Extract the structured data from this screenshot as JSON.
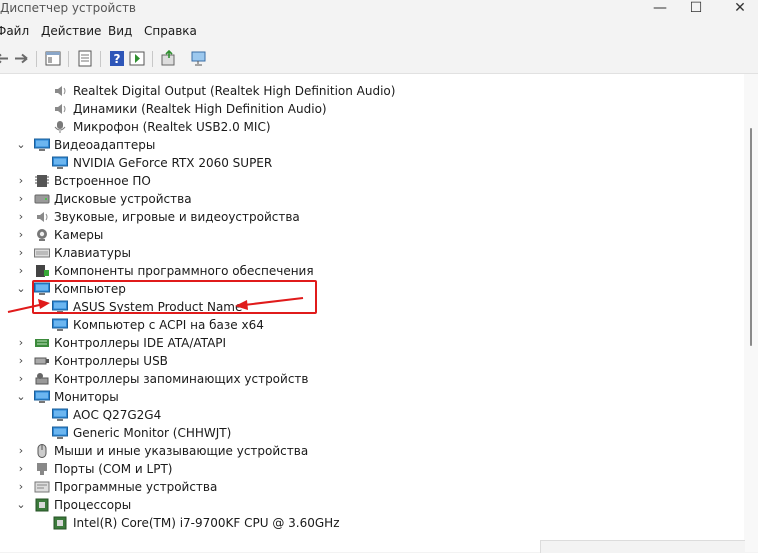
{
  "window": {
    "title": "Диспетчер устройств",
    "minimize_glyph": "—",
    "maximize_glyph": "☐",
    "close_glyph": "✕"
  },
  "menu": {
    "items": [
      "Файл",
      "Действие",
      "Вид",
      "Справка"
    ]
  },
  "toolbar": {
    "buttons": [
      "back-icon",
      "forward-icon",
      "properties-pane-icon",
      "show-hidden-icon",
      "help-icon",
      "action-pane-icon",
      "update-driver-icon",
      "scan-hardware-icon"
    ]
  },
  "tree": {
    "rows": [
      {
        "label": "Realtek Digital Output (Realtek High Definition Audio)",
        "level": 2,
        "icon": "speaker-device-icon"
      },
      {
        "label": "Динамики (Realtek High Definition Audio)",
        "level": 2,
        "icon": "speaker-icon"
      },
      {
        "label": "Микрофон (Realtek USB2.0 MIC)",
        "level": 2,
        "icon": "microphone-icon"
      },
      {
        "label": "Видеоадаптеры",
        "level": 1,
        "expanded": true,
        "icon": "display-adapter-icon"
      },
      {
        "label": "NVIDIA GeForce RTX 2060 SUPER",
        "level": 2,
        "icon": "display-adapter-icon"
      },
      {
        "label": "Встроенное ПО",
        "level": 1,
        "expanded": false,
        "icon": "firmware-icon"
      },
      {
        "label": "Дисковые устройства",
        "level": 1,
        "expanded": false,
        "icon": "disk-icon"
      },
      {
        "label": "Звуковые, игровые и видеоустройства",
        "level": 1,
        "expanded": false,
        "icon": "speaker-icon"
      },
      {
        "label": "Камеры",
        "level": 1,
        "expanded": false,
        "icon": "camera-icon"
      },
      {
        "label": "Клавиатуры",
        "level": 1,
        "expanded": false,
        "icon": "keyboard-icon"
      },
      {
        "label": "Компоненты программного обеспечения",
        "level": 1,
        "expanded": false,
        "icon": "software-component-icon"
      },
      {
        "label": "Компьютер",
        "level": 1,
        "expanded": true,
        "icon": "monitor-icon"
      },
      {
        "label": "ASUS System Product Name",
        "level": 2,
        "icon": "monitor-icon"
      },
      {
        "label": "Компьютер с ACPI на базе x64",
        "level": 2,
        "icon": "monitor-icon"
      },
      {
        "label": "Контроллеры IDE ATA/ATAPI",
        "level": 1,
        "expanded": false,
        "icon": "ide-controller-icon"
      },
      {
        "label": "Контроллеры USB",
        "level": 1,
        "expanded": false,
        "icon": "usb-icon"
      },
      {
        "label": "Контроллеры запоминающих устройств",
        "level": 1,
        "expanded": false,
        "icon": "storage-controller-icon"
      },
      {
        "label": "Мониторы",
        "level": 1,
        "expanded": true,
        "icon": "monitor-icon"
      },
      {
        "label": "AOC Q27G2G4",
        "level": 2,
        "icon": "monitor-icon"
      },
      {
        "label": "Generic Monitor (CHHWJT)",
        "level": 2,
        "icon": "monitor-icon"
      },
      {
        "label": "Мыши и иные указывающие устройства",
        "level": 1,
        "expanded": false,
        "icon": "mouse-icon"
      },
      {
        "label": "Порты (COM и LPT)",
        "level": 1,
        "expanded": false,
        "icon": "port-icon"
      },
      {
        "label": "Программные устройства",
        "level": 1,
        "expanded": false,
        "icon": "software-device-icon"
      },
      {
        "label": "Процессоры",
        "level": 1,
        "expanded": true,
        "icon": "processor-icon"
      },
      {
        "label": "Intel(R) Core(TM) i7-9700KF CPU @ 3.60GHz",
        "level": 2,
        "icon": "processor-icon"
      }
    ]
  },
  "annotation": {
    "highlighted_row": "ASUS System Product Name",
    "color": "#e01b1b"
  },
  "colors": {
    "accent": "#2b88d8",
    "annotation": "#e01b1b"
  }
}
